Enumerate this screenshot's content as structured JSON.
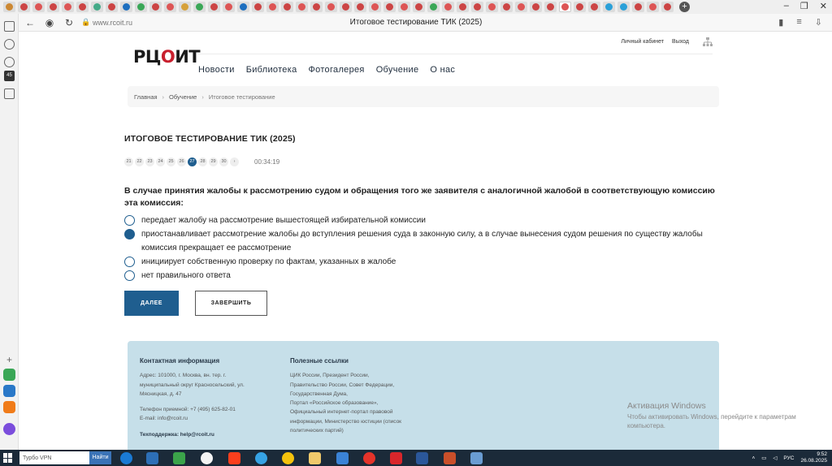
{
  "browser": {
    "address": "www.rcoit.ru",
    "tab_title": "Итоговое тестирование ТИК (2025)"
  },
  "site": {
    "logo": {
      "left": "РЦ",
      "check": "О",
      "right": "ИТ"
    },
    "top_links": [
      "Личный кабинет",
      "Выход"
    ],
    "nav": [
      "Новости",
      "Библиотека",
      "Фотогалерея",
      "Обучение",
      "О нас"
    ],
    "breadcrumbs": [
      "Главная",
      "Обучение",
      "Итоговое тестирование"
    ]
  },
  "test": {
    "title": "ИТОГОВОЕ ТЕСТИРОВАНИЕ ТИК (2025)",
    "question_numbers": [
      "21",
      "22",
      "23",
      "24",
      "25",
      "26",
      "27",
      "28",
      "29",
      "30",
      "›"
    ],
    "current_question": "27",
    "timer": "00:34:19",
    "question": "В случае принятия жалобы к рассмотрению судом и обращения того же заявителя с аналогичной жалобой в соответствующую комиссию эта комиссия:",
    "answers": [
      {
        "text": "передает жалобу на рассмотрение вышестоящей избирательной комиссии",
        "selected": false
      },
      {
        "text": "приостанавливает рассмотрение жалобы до вступления решения суда в законную силу, а в случае вынесения судом решения по существу жалобы комиссия прекращает ее рассмотрение",
        "selected": true
      },
      {
        "text": "инициирует собственную проверку по фактам, указанных в жалобе",
        "selected": false
      },
      {
        "text": "нет правильного ответа",
        "selected": false
      }
    ],
    "btn_next": "ДАЛЕЕ",
    "btn_finish": "ЗАВЕРШИТЬ"
  },
  "footer": {
    "contacts": {
      "title": "Контактная информация",
      "address": [
        "Адрес: 101000, г. Москва, вн. тер. г.",
        "муниципальный округ Красносельский, ул.",
        "Мясницкая, д. 47"
      ],
      "phone": "Телефон приемной: +7 (495) 625-82-01",
      "email": "E-mail: info@rcoit.ru",
      "support": "Техподдержка: help@rcoit.ru"
    },
    "links": {
      "title": "Полезные ссылки",
      "lines": [
        "ЦИК России, Президент России,",
        "Правительство России, Совет Федерации,",
        "Государственная Дума,",
        "Портал «Российское образование»,",
        "Официальный интернет-портал правовой",
        "информации, Министерство юстиции (список",
        "политических партий)"
      ]
    }
  },
  "windows": {
    "activation_title": "Активация Windows",
    "activation_text": [
      "Чтобы активировать Windows, перейдите к параметрам",
      "компьютера."
    ],
    "search_placeholder": "Турбо VPN",
    "search_button": "Найти",
    "lang": "РУС",
    "time": "9:52",
    "date": "26.08.2025"
  },
  "colors": {
    "accent": "#1f5e8f",
    "footer_bg": "#c6dfe9",
    "logo_red": "#c8202e"
  }
}
